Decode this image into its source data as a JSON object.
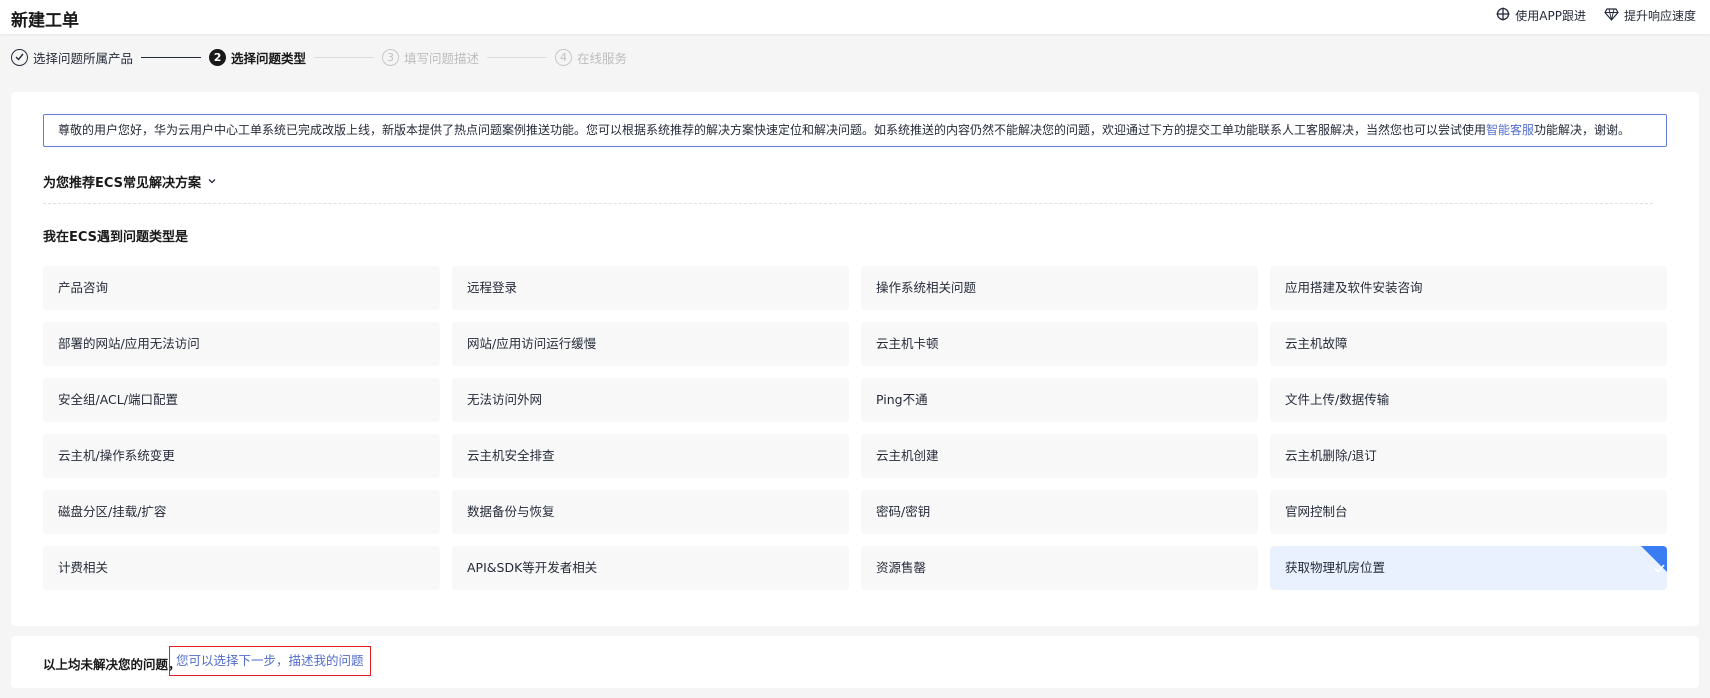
{
  "header": {
    "title": "新建工单",
    "actions": [
      {
        "label": "使用APP跟进",
        "icon": "app-track-icon"
      },
      {
        "label": "提升响应速度",
        "icon": "diamond-icon"
      }
    ]
  },
  "steps": [
    {
      "num": "✓",
      "label": "选择问题所属产品",
      "state": "done"
    },
    {
      "num": "2",
      "label": "选择问题类型",
      "state": "active"
    },
    {
      "num": "3",
      "label": "填写问题描述",
      "state": "pending"
    },
    {
      "num": "4",
      "label": "在线服务",
      "state": "pending"
    }
  ],
  "notice": {
    "text_before": "尊敬的用户您好，华为云用户中心工单系统已完成改版上线，新版本提供了热点问题案例推送功能。您可以根据系统推荐的解决方案快速定位和解决问题。如系统推送的内容仍然不能解决您的问题，欢迎通过下方的提交工单功能联系人工客服解决，当然您也可以尝试使用",
    "link": "智能客服",
    "text_after": "功能解决，谢谢。"
  },
  "recommend": {
    "label": "为您推荐ECS常见解决方案"
  },
  "type_heading": "我在ECS遇到问题类型是",
  "types": [
    "产品咨询",
    "远程登录",
    "操作系统相关问题",
    "应用搭建及软件安装咨询",
    "部署的网站/应用无法访问",
    "网站/应用访问运行缓慢",
    "云主机卡顿",
    "云主机故障",
    "安全组/ACL/端口配置",
    "无法访问外网",
    "Ping不通",
    "文件上传/数据传输",
    "云主机/操作系统变更",
    "云主机安全排查",
    "云主机创建",
    "云主机删除/退订",
    "磁盘分区/挂载/扩容",
    "数据备份与恢复",
    "密码/密钥",
    "官网控制台",
    "计费相关",
    "API&SDK等开发者相关",
    "资源售罄",
    "获取物理机房位置"
  ],
  "selected_type": "获取物理机房位置",
  "colors": {
    "accent": "#3a7cf2",
    "link": "#526ecc",
    "highlight_border": "#e02020"
  },
  "footer": {
    "text": "以上均未解决您的问题，",
    "link": "您可以选择下一步，描述我的问题"
  }
}
